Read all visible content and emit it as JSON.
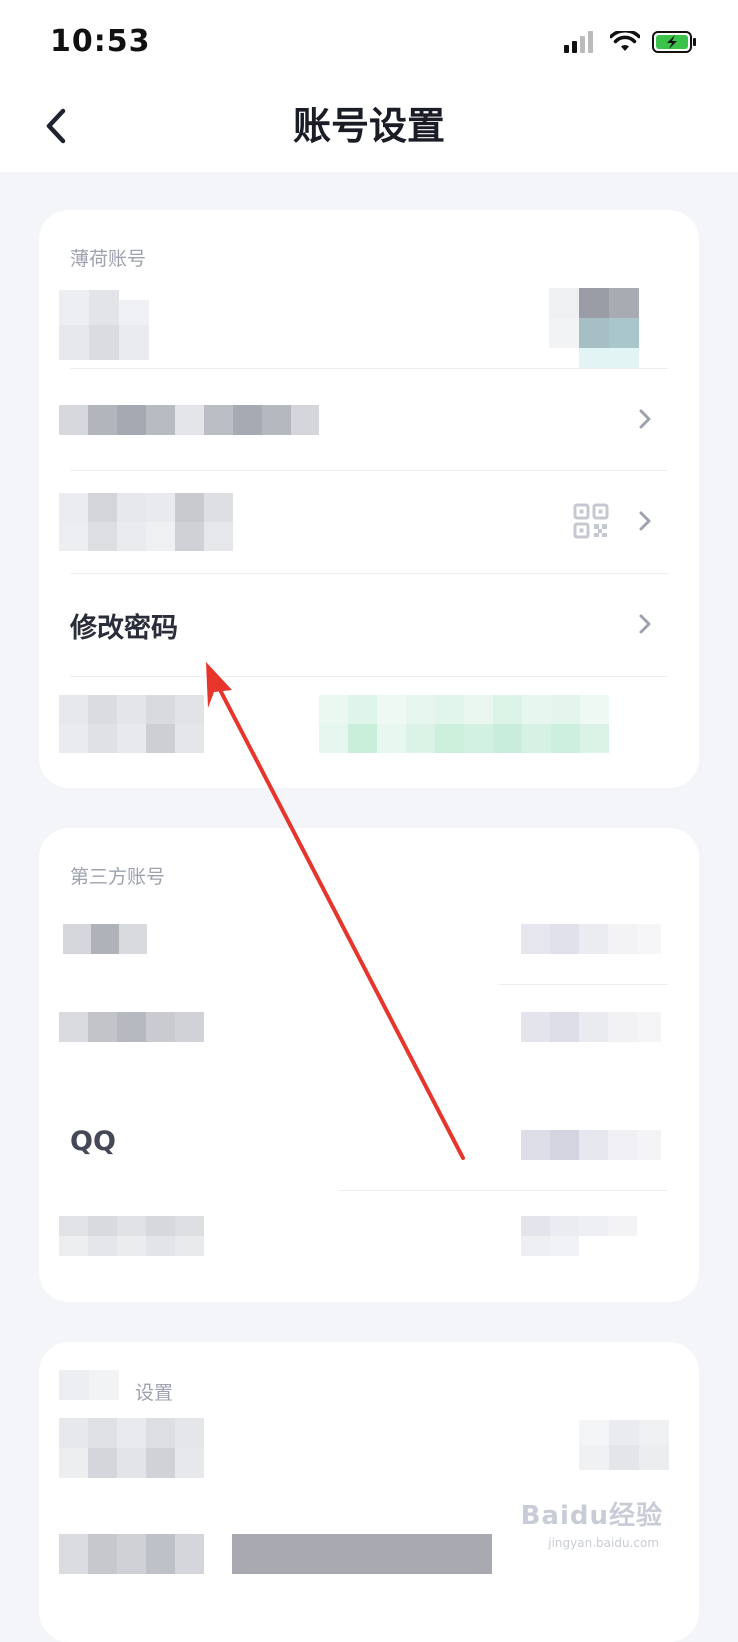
{
  "status_bar": {
    "time": "10:53"
  },
  "nav": {
    "title": "账号设置"
  },
  "sections": {
    "bohe_account": {
      "label": "薄荷账号",
      "rows": {
        "change_password": "修改密码"
      }
    },
    "third_party": {
      "label": "第三方账号",
      "rows": {
        "qq": "QQ"
      }
    },
    "settings": {
      "label": "设置"
    }
  },
  "watermark": {
    "text": "Baidu经验",
    "sub": "jingyan.baidu.com"
  },
  "colors": {
    "accent_arrow": "#e8352b",
    "background": "#f4f5f9",
    "card": "#ffffff"
  }
}
